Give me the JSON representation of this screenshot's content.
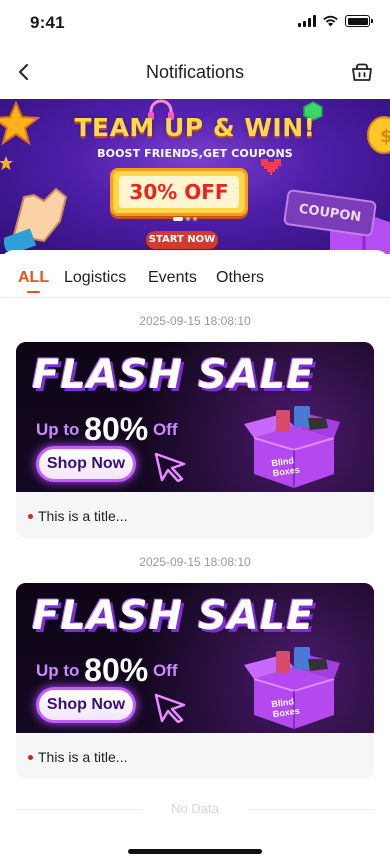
{
  "status_bar": {
    "time": "9:41"
  },
  "nav": {
    "title": "Notifications",
    "back_icon": "chevron-left-icon",
    "shop_icon": "shop-basket-icon"
  },
  "banner": {
    "headline": "TEAM UP & WIN!",
    "subtitle": "BOOST FRIENDS,GET COUPONS",
    "discount": "30% OFF",
    "coupon": "COUPON",
    "cta": "START NOW"
  },
  "tabs": [
    {
      "label": "ALL",
      "active": true
    },
    {
      "label": "Logistics",
      "active": false
    },
    {
      "label": "Events",
      "active": false
    },
    {
      "label": "Others",
      "active": false
    }
  ],
  "notifications": [
    {
      "timestamp": "2025-09-15 18:08:10",
      "hero": {
        "headline": "FLASH SALE",
        "up_to": "Up to",
        "percent": "80%",
        "off": "Off",
        "button": "Shop Now",
        "box_label": "Blind Boxes"
      },
      "title": "This is a title..."
    },
    {
      "timestamp": "2025-09-15 18:08:10",
      "hero": {
        "headline": "FLASH SALE",
        "up_to": "Up to",
        "percent": "80%",
        "off": "Off",
        "button": "Shop Now",
        "box_label": "Blind Boxes"
      },
      "title": "This is a title..."
    }
  ],
  "empty_text": "No Data",
  "colors": {
    "accent": "#e5531e",
    "unread_dot": "#d9241c",
    "banner_purple": "#4e1ea8"
  }
}
